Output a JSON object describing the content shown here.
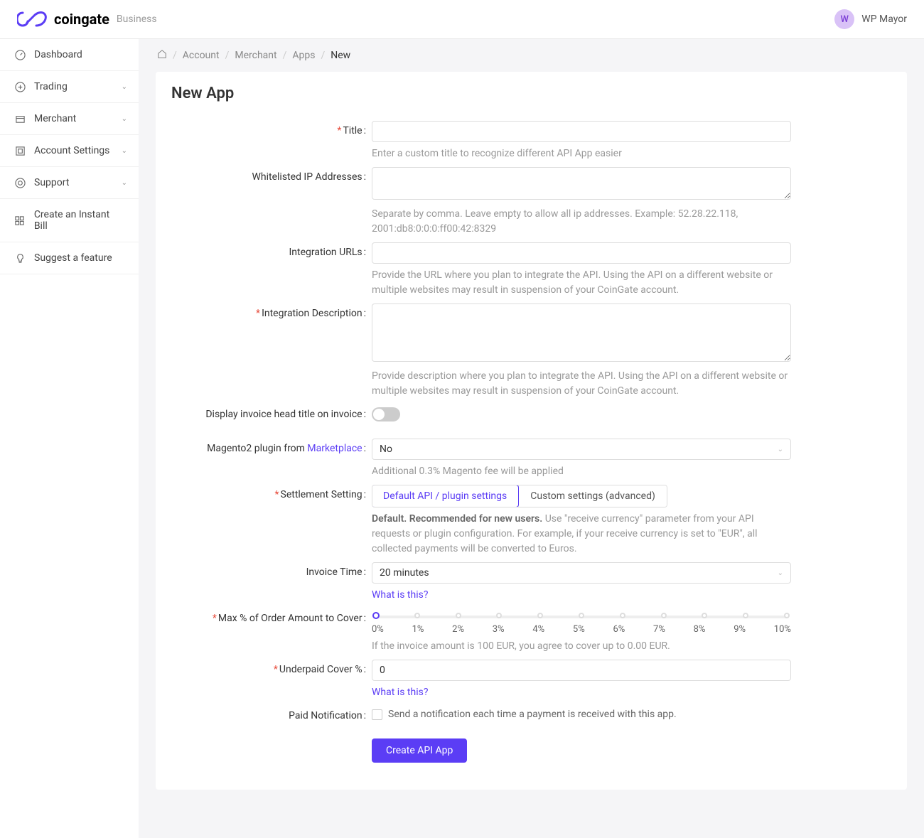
{
  "header": {
    "brand": "coingate",
    "sub": "Business",
    "avatar_initial": "W",
    "user_name": "WP Mayor"
  },
  "sidebar": {
    "items": [
      {
        "label": "Dashboard",
        "expandable": false
      },
      {
        "label": "Trading",
        "expandable": true
      },
      {
        "label": "Merchant",
        "expandable": true
      },
      {
        "label": "Account Settings",
        "expandable": true
      },
      {
        "label": "Support",
        "expandable": true
      },
      {
        "label": "Create an Instant Bill",
        "expandable": false
      },
      {
        "label": "Suggest a feature",
        "expandable": false
      }
    ]
  },
  "breadcrumb": {
    "items": [
      "Account",
      "Merchant",
      "Apps"
    ],
    "current": "New"
  },
  "page": {
    "title": "New App"
  },
  "form": {
    "title": {
      "label": "Title",
      "help": "Enter a custom title to recognize different API App easier"
    },
    "whitelisted": {
      "label": "Whitelisted IP Addresses",
      "help": "Separate by comma. Leave empty to allow all ip addresses. Example: 52.28.22.118, 2001:db8:0:0:0:ff00:42:8329"
    },
    "integration_urls": {
      "label": "Integration URLs",
      "help": "Provide the URL where you plan to integrate the API. Using the API on a different website or multiple websites may result in suspension of your CoinGate account."
    },
    "integration_desc": {
      "label": "Integration Description",
      "help": "Provide description where you plan to integrate the API. Using the API on a different website or multiple websites may result in suspension of your CoinGate account."
    },
    "display_invoice_head": {
      "label": "Display invoice head title on invoice"
    },
    "magento": {
      "label_prefix": "Magento2 plugin from ",
      "label_link": "Marketplace",
      "value": "No",
      "help": "Additional 0.3% Magento fee will be applied"
    },
    "settlement": {
      "label": "Settlement Setting",
      "options": [
        "Default API / plugin settings",
        "Custom settings (advanced)"
      ],
      "help_bold": "Default. Recommended for new users.",
      "help_rest": " Use \"receive currency\" parameter from your API requests or plugin configuration. For example, if your receive currency is set to \"EUR\", all collected payments will be converted to Euros."
    },
    "invoice_time": {
      "label": "Invoice Time",
      "value": "20 minutes",
      "link": "What is this?"
    },
    "max_pct": {
      "label": "Max % of Order Amount to Cover",
      "ticks": [
        "0%",
        "1%",
        "2%",
        "3%",
        "4%",
        "5%",
        "6%",
        "7%",
        "8%",
        "9%",
        "10%"
      ],
      "help": "If the invoice amount is 100 EUR, you agree to cover up to 0.00 EUR."
    },
    "underpaid": {
      "label": "Underpaid Cover %",
      "value": "0",
      "link": "What is this?"
    },
    "paid_notification": {
      "label": "Paid Notification",
      "text": "Send a notification each time a payment is received with this app."
    },
    "submit": "Create API App"
  }
}
